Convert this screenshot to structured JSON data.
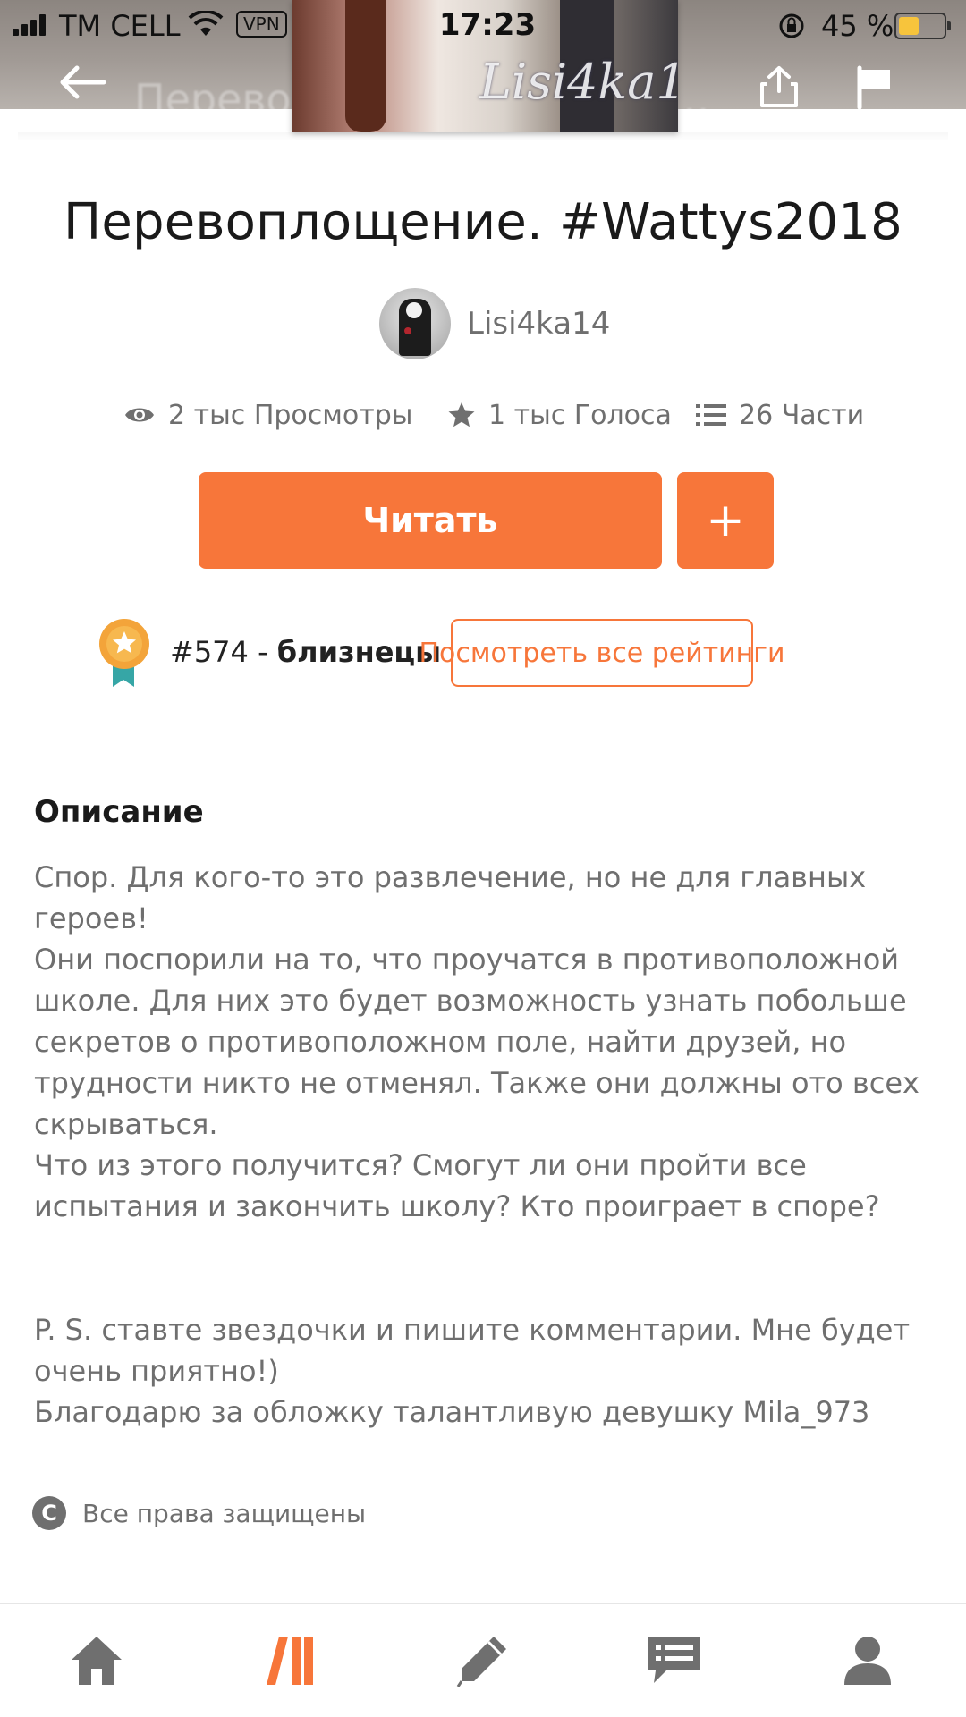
{
  "status_bar": {
    "carrier": "TM CELL",
    "vpn": "VPN",
    "time": "17:23",
    "battery_pct": "45 %",
    "battery_level": 0.45
  },
  "header": {
    "title": "Перевоплощение. #Wattys2018",
    "cover_watermark": "Lisi4ka14",
    "icons": {
      "back": "arrow-left-icon",
      "share": "share-icon",
      "flag": "flag-icon"
    }
  },
  "story": {
    "title": "Перевоплощение. #Wattys2018",
    "author": "Lisi4ka14",
    "stats": {
      "views": "2 тыс Просмотры",
      "votes": "1 тыс Голоса",
      "parts": "26 Части"
    },
    "read_label": "Читать",
    "add_label": "+",
    "rank_number": "#574 - ",
    "rank_tag": "близнецы",
    "ratings_label": "Посмотреть все рейтинги"
  },
  "description": {
    "heading": "Описание",
    "paragraphs_1": [
      "Спор. Для кого-то это развлечение, но не для главных героев!",
      "Они поспорили на то, что проучатся в противоположной школе. Для них это будет возможность узнать побольше секретов о противоположном поле, найти друзей, но трудности никто не отменял. Также они должны ото всех скрываться.",
      "Что из этого получится? Смогут ли они пройти все испытания и закончить школу? Кто проиграет в споре?"
    ],
    "paragraphs_2": [
      "P. S. ставте звездочки и пишите комментарии. Мне будет очень приятно!)",
      "Благодарю за обложку талантливую девушку Mila_973"
    ]
  },
  "copyright": {
    "icon_glyph": "C",
    "text": "Все права защищены"
  },
  "bottom_nav": {
    "items": [
      "home-icon",
      "library-icon",
      "pencil-icon",
      "messages-icon",
      "profile-icon"
    ],
    "active": "library-icon"
  },
  "colors": {
    "accent": "#f7763a",
    "text_primary": "#1a1a1a",
    "text_secondary": "#6f6f6f"
  }
}
